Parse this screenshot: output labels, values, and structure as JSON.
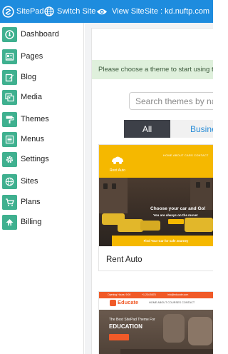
{
  "topbar": {
    "brand": "SitePad",
    "switch_site": "Switch Site",
    "view_site": "View Site",
    "site_label": "Site : kd.nuftp.com"
  },
  "colors": {
    "topbar": "#1e8cde",
    "sidebar_icon": "#3fb08f",
    "notice_bg": "#dff0dc",
    "tab_active": "#3d4048",
    "accent_yellow": "#f5b800",
    "accent_orange": "#f05a28"
  },
  "sidebar": {
    "items": [
      {
        "label": "Dashboard",
        "icon": "dashboard-icon"
      },
      {
        "label": "Pages",
        "icon": "pages-icon"
      },
      {
        "label": "Blog",
        "icon": "blog-icon"
      },
      {
        "label": "Media",
        "icon": "media-icon"
      },
      {
        "label": "Themes",
        "icon": "themes-icon"
      },
      {
        "label": "Menus",
        "icon": "menus-icon"
      },
      {
        "label": "Settings",
        "icon": "settings-icon"
      },
      {
        "label": "Sites",
        "icon": "sites-icon"
      },
      {
        "label": "Plans",
        "icon": "plans-icon"
      },
      {
        "label": "Billing",
        "icon": "billing-icon"
      }
    ]
  },
  "main": {
    "notice": "Please choose a theme to start using th",
    "search_placeholder": "Search themes by na",
    "tabs": [
      {
        "label": "All",
        "active": true
      },
      {
        "label": "Busine",
        "active": false
      }
    ],
    "themes": [
      {
        "name": "Rent Auto",
        "preview": {
          "logo_text": "Rent Auto",
          "menu": "HOME   ABOUT   CARS   CONTACT",
          "headline": "Choose your car and Go!",
          "subheadline": "You are always on the move!",
          "band": "Find Your Car for safe Journey"
        }
      },
      {
        "name": "Educate",
        "preview": {
          "topbar_left": "Opening Hours: 9:00",
          "topbar_mid": "+1 234 5678",
          "topbar_right": "info@educate.com",
          "logo_text": "Educate",
          "menu": "HOME  ABOUT  COURSES  CONTACT",
          "hero_line1": "The Best SitePad Theme For",
          "hero_line2": "EDUCATION"
        }
      }
    ]
  }
}
